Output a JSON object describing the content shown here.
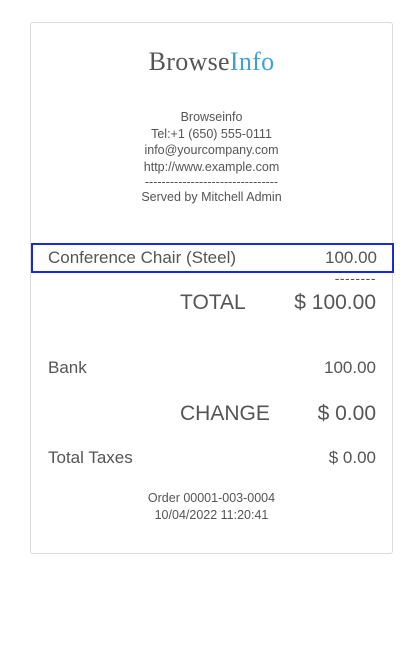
{
  "logo": {
    "part1": "Browse",
    "part2": "Info"
  },
  "company": {
    "name": "Browseinfo",
    "phone": "Tel:+1 (650) 555-0111",
    "email": "info@yourcompany.com",
    "website": "http://www.example.com",
    "separator": "--------------------------------",
    "served_by": "Served by Mitchell Admin"
  },
  "line_items": [
    {
      "name": "Conference Chair (Steel)",
      "price": "100.00"
    }
  ],
  "subtotal_dashes": "--------",
  "total": {
    "label": "TOTAL",
    "value": "$ 100.00"
  },
  "payment": {
    "method": "Bank",
    "amount": "100.00"
  },
  "change": {
    "label": "CHANGE",
    "value": "$ 0.00"
  },
  "taxes": {
    "label": "Total Taxes",
    "value": "$ 0.00"
  },
  "order": {
    "ref": "Order 00001-003-0004",
    "datetime": "10/04/2022 11:20:41"
  },
  "colors": {
    "logo_accent": "#3fa0d8",
    "selection_border": "#1a2ad4"
  }
}
